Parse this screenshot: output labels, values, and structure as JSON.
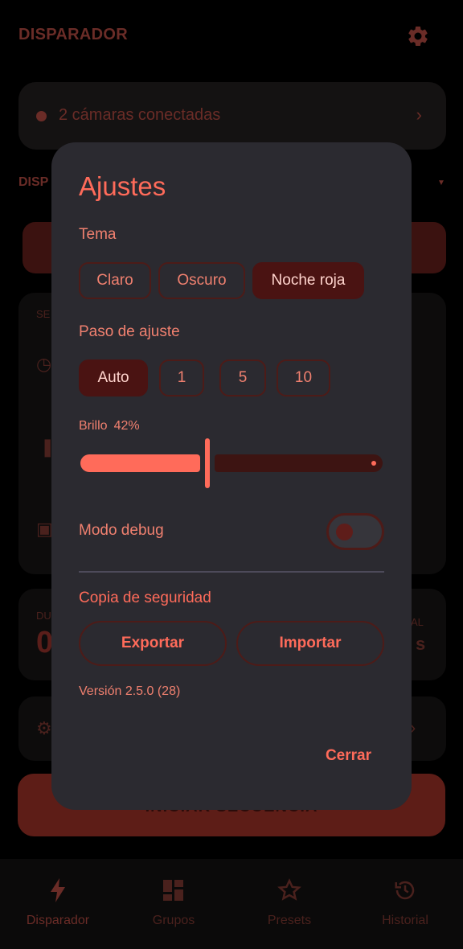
{
  "app": {
    "title": "DISPARADOR",
    "cameras_status": "2 cámaras conectadas",
    "section_label": "DISP",
    "bg_se": "SE",
    "bg_du": "DU",
    "bg_zero": "0",
    "bg_al": "AL",
    "bg_s": "s",
    "start_button": "INICIAR SECUENCIA"
  },
  "bottom_nav": {
    "items": [
      {
        "label": "Disparador",
        "icon": "bolt-icon"
      },
      {
        "label": "Grupos",
        "icon": "grid-icon"
      },
      {
        "label": "Presets",
        "icon": "star-icon"
      },
      {
        "label": "Historial",
        "icon": "history-icon"
      }
    ]
  },
  "dialog": {
    "title": "Ajustes",
    "theme": {
      "label": "Tema",
      "options": [
        "Claro",
        "Oscuro",
        "Noche roja"
      ],
      "selected": "Noche roja"
    },
    "step": {
      "label": "Paso de ajuste",
      "options": [
        "Auto",
        "1",
        "5",
        "10"
      ],
      "selected": "Auto"
    },
    "brightness": {
      "label": "Brillo",
      "value_text": "42%",
      "value": 0.42
    },
    "debug": {
      "label": "Modo debug",
      "enabled": false
    },
    "backup": {
      "label": "Copia de seguridad",
      "export_label": "Exportar",
      "import_label": "Importar"
    },
    "version": "Versión 2.5.0 (28)",
    "close_label": "Cerrar"
  },
  "colors": {
    "accent": "#ff6b5a",
    "dialog_bg": "#2b2a30",
    "chip_selected": "#4a1312"
  }
}
